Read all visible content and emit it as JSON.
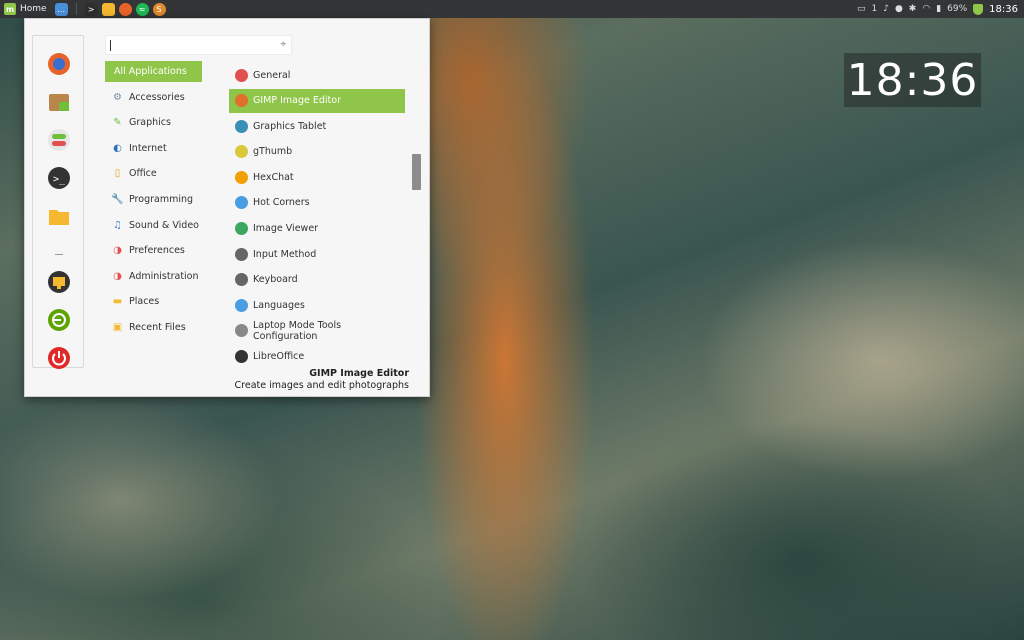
{
  "top_panel": {
    "menu_label": "Home",
    "launchers": [
      {
        "name": "show-desktop",
        "icon": "desktop-icon",
        "color": "#4a90d9"
      },
      {
        "name": "terminal",
        "icon": "terminal-icon",
        "color": "#2e2e2e"
      },
      {
        "name": "files",
        "icon": "folder-icon",
        "color": "#f5b82e"
      },
      {
        "name": "firefox",
        "icon": "firefox-icon",
        "color": "#e8632b"
      },
      {
        "name": "spotify",
        "icon": "spotify-icon",
        "color": "#1db954"
      },
      {
        "name": "sublime",
        "icon": "sublime-icon",
        "color": "#e08a2c"
      }
    ],
    "tray": {
      "notifications": "1",
      "battery": "69%",
      "clock": "18:36"
    }
  },
  "desklet": {
    "clock": "18:36"
  },
  "menu": {
    "search": {
      "value": "",
      "placeholder": ""
    },
    "favorites": [
      {
        "name": "firefox",
        "icon": "firefox-icon",
        "color": "#e8632b"
      },
      {
        "name": "software-manager",
        "icon": "package-icon",
        "color": "#b8854a"
      },
      {
        "name": "settings",
        "icon": "toggle-settings-icon",
        "color": "#e05050"
      },
      {
        "name": "terminal",
        "icon": "terminal-icon",
        "color": "#333333"
      },
      {
        "name": "files",
        "icon": "folder-icon",
        "color": "#f5b82e"
      }
    ],
    "session": [
      {
        "name": "lock-screen",
        "icon": "lock-screen-icon",
        "color": "#333333"
      },
      {
        "name": "logout",
        "icon": "logout-icon",
        "color": "#5fa300"
      },
      {
        "name": "shutdown",
        "icon": "power-icon",
        "color": "#e02828"
      }
    ],
    "categories": [
      {
        "label": "All Applications",
        "icon": "all-apps-icon",
        "active": true
      },
      {
        "label": "Accessories",
        "icon": "accessories-icon"
      },
      {
        "label": "Graphics",
        "icon": "graphics-icon"
      },
      {
        "label": "Internet",
        "icon": "internet-icon"
      },
      {
        "label": "Office",
        "icon": "office-icon"
      },
      {
        "label": "Programming",
        "icon": "wrench-icon"
      },
      {
        "label": "Sound & Video",
        "icon": "music-note-icon"
      },
      {
        "label": "Preferences",
        "icon": "preferences-icon"
      },
      {
        "label": "Administration",
        "icon": "administration-icon"
      },
      {
        "label": "Places",
        "icon": "folder-icon"
      },
      {
        "label": "Recent Files",
        "icon": "recent-files-icon"
      }
    ],
    "apps": [
      {
        "label": "General",
        "icon": "general-settings-icon",
        "color": "#e05050"
      },
      {
        "label": "GIMP Image Editor",
        "icon": "gimp-icon",
        "color": "#e0702a",
        "active": true
      },
      {
        "label": "Graphics Tablet",
        "icon": "tablet-icon",
        "color": "#3a8fb7"
      },
      {
        "label": "gThumb",
        "icon": "gthumb-icon",
        "color": "#d8c83a"
      },
      {
        "label": "HexChat",
        "icon": "hexchat-icon",
        "color": "#f0a000"
      },
      {
        "label": "Hot Corners",
        "icon": "hot-corners-icon",
        "color": "#4a9de0"
      },
      {
        "label": "Image Viewer",
        "icon": "image-viewer-icon",
        "color": "#3aa860"
      },
      {
        "label": "Input Method",
        "icon": "keyboard-icon",
        "color": "#666666"
      },
      {
        "label": "Keyboard",
        "icon": "keyboard-icon",
        "color": "#666666"
      },
      {
        "label": "Languages",
        "icon": "flag-icon",
        "color": "#4a9de0"
      },
      {
        "label": "Laptop Mode Tools Configuration",
        "icon": "gear-icon",
        "color": "#888888"
      },
      {
        "label": "LibreOffice",
        "icon": "libreoffice-icon",
        "color": "#333333"
      }
    ],
    "description": {
      "title": "GIMP Image Editor",
      "subtitle": "Create images and edit photographs"
    },
    "accent_color": "#8fc549"
  }
}
